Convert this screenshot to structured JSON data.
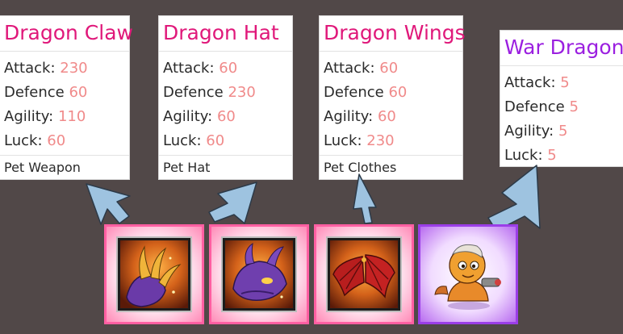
{
  "stat_labels": {
    "attack": "Attack:",
    "defence": "Defence",
    "agility": "Agility:",
    "luck": "Luck:"
  },
  "items": [
    {
      "name": "Dragon Claw",
      "attack": "230",
      "defence": "60",
      "agility": "110",
      "luck": "60",
      "type": "Pet Weapon",
      "rarity_color": "#ff5fa2",
      "title_color": "#e0187a",
      "icon": "dragon-claw-icon"
    },
    {
      "name": "Dragon Hat",
      "attack": "60",
      "defence": "230",
      "agility": "60",
      "luck": "60",
      "type": "Pet Hat",
      "rarity_color": "#ff5fa2",
      "title_color": "#e0187a",
      "icon": "dragon-hat-icon"
    },
    {
      "name": "Dragon Wings",
      "attack": "60",
      "defence": "60",
      "agility": "60",
      "luck": "230",
      "type": "Pet Clothes",
      "rarity_color": "#ff5fa2",
      "title_color": "#e0187a",
      "icon": "dragon-wings-icon"
    },
    {
      "name": "War Dragon",
      "attack": "5",
      "defence": "5",
      "agility": "5",
      "luck": "5",
      "rarity_color": "#9b3ee8",
      "title_color": "#9b1fe0",
      "icon": "war-dragon-pet-icon"
    }
  ],
  "colors": {
    "background": "#514848",
    "stat_value": "#f08a8a",
    "arrow_fill": "#9ec3e0",
    "arrow_stroke": "#2c3a48"
  }
}
